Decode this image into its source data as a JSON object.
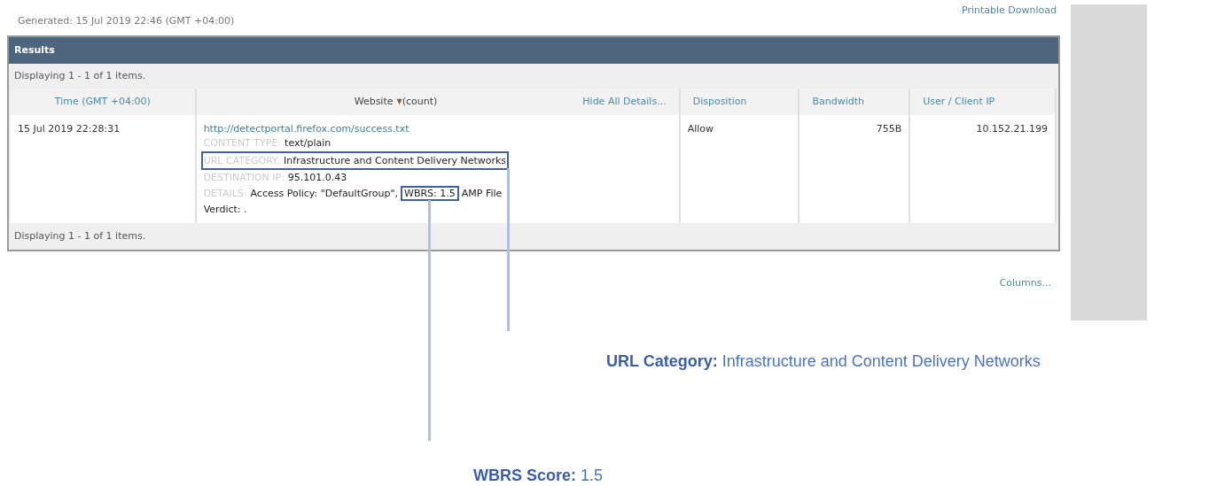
{
  "generated": "Generated: 15 Jul 2019 22:46 (GMT +04:00)",
  "printable_link": "Printable Download",
  "panel": {
    "title": "Results",
    "top_status": "Displaying 1 - 1 of 1 items.",
    "bottom_status": "Displaying 1 - 1 of 1 items."
  },
  "table": {
    "columns": [
      {
        "label": "Time (GMT +04:00)",
        "kind": "link"
      },
      {
        "label": "Website",
        "sort": "▼",
        "suffix": "(count)",
        "action": "Hide All Details...",
        "kind": "plain"
      },
      {
        "label": "Disposition",
        "kind": "link"
      },
      {
        "label": "Bandwidth",
        "kind": "link"
      },
      {
        "label": "User / Client IP",
        "kind": "link"
      }
    ],
    "rows": [
      {
        "time": "15 Jul 2019 22:28:31",
        "url": "http://detectportal.firefox.com/success.txt",
        "details": [
          {
            "label": "CONTENT TYPE:",
            "value": "text/plain",
            "highlighted": false
          },
          {
            "label": "URL CATEGORY:",
            "value": "Infrastructure and Content Delivery Networks",
            "highlighted": true
          },
          {
            "label": "DESTINATION IP:",
            "value": "95.101.0.43",
            "highlighted": false
          },
          {
            "label": "DETAILS:",
            "value": "Access Policy: \"DefaultGroup\",",
            "mark": "WBRS: 1.5",
            "rest": [
              "AMP File",
              "Verdict: ."
            ],
            "highlighted": false
          }
        ],
        "disposition": "Allow",
        "bandwidth": "755B",
        "client_ip": "10.152.21.199"
      }
    ]
  },
  "columns_link": "Columns...",
  "annotations": [
    {
      "text": "**URL Category:** Infrastructure and Content Delivery Networks"
    },
    {
      "text": "**WBRS Score:** 1.5"
    }
  ]
}
